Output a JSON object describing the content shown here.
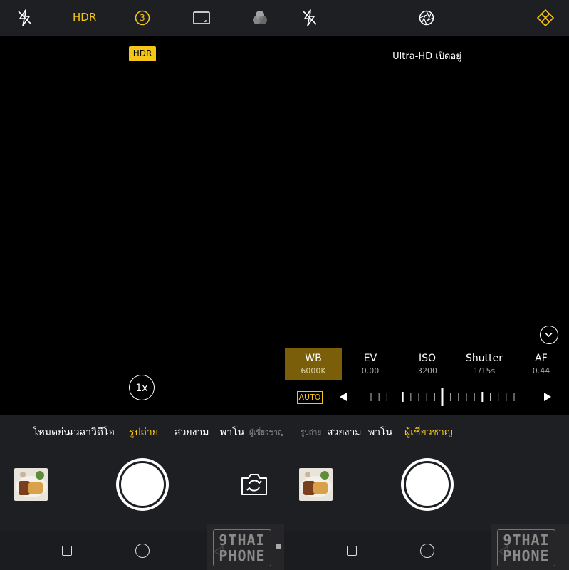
{
  "left_panel": {
    "top_bar": {
      "flash_icon": "flash-off-icon",
      "hdr_label": "HDR",
      "timer_label": "3",
      "aspect_icon": "aspect-ratio-icon",
      "filter_icon": "color-filter-icon"
    },
    "viewfinder": {
      "hdr_badge": "HDR",
      "zoom_label": "1x"
    },
    "modes": [
      {
        "label": "โหมดย่นเวลา",
        "active": false
      },
      {
        "label": "วิดีโอ",
        "active": false
      },
      {
        "label": "รูปถ่าย",
        "active": true
      },
      {
        "label": "สวยงาม",
        "active": false
      },
      {
        "label": "พาโน",
        "active": false
      },
      {
        "label": "ผู้เชี่ยวชาญ",
        "active": false
      }
    ]
  },
  "right_panel": {
    "top_bar": {
      "flash_icon": "flash-off-icon",
      "aperture_icon": "aperture-icon",
      "expert_icon": "diamond-grid-icon"
    },
    "viewfinder": {
      "status_text": "Ultra-HD เปิดอยู่"
    },
    "pro_controls": [
      {
        "key": "WB",
        "value": "6000K",
        "active": true
      },
      {
        "key": "EV",
        "value": "0.00",
        "active": false
      },
      {
        "key": "ISO",
        "value": "3200",
        "active": false
      },
      {
        "key": "Shutter",
        "value": "1/15s",
        "active": false
      },
      {
        "key": "AF",
        "value": "0.44",
        "active": false
      }
    ],
    "auto_badge": "AUTO",
    "modes": [
      {
        "label": "รูปถ่าย",
        "active": false
      },
      {
        "label": "สวยงาม",
        "active": false
      },
      {
        "label": "พาโน",
        "active": false
      },
      {
        "label": "ผู้เชี่ยวชาญ",
        "active": true
      }
    ]
  },
  "watermark": {
    "line1": "9THAI",
    "line2": "PHONE"
  },
  "colors": {
    "accent": "#f5c518",
    "bar": "#1e1f23",
    "active_control": "#7a5e0a"
  }
}
